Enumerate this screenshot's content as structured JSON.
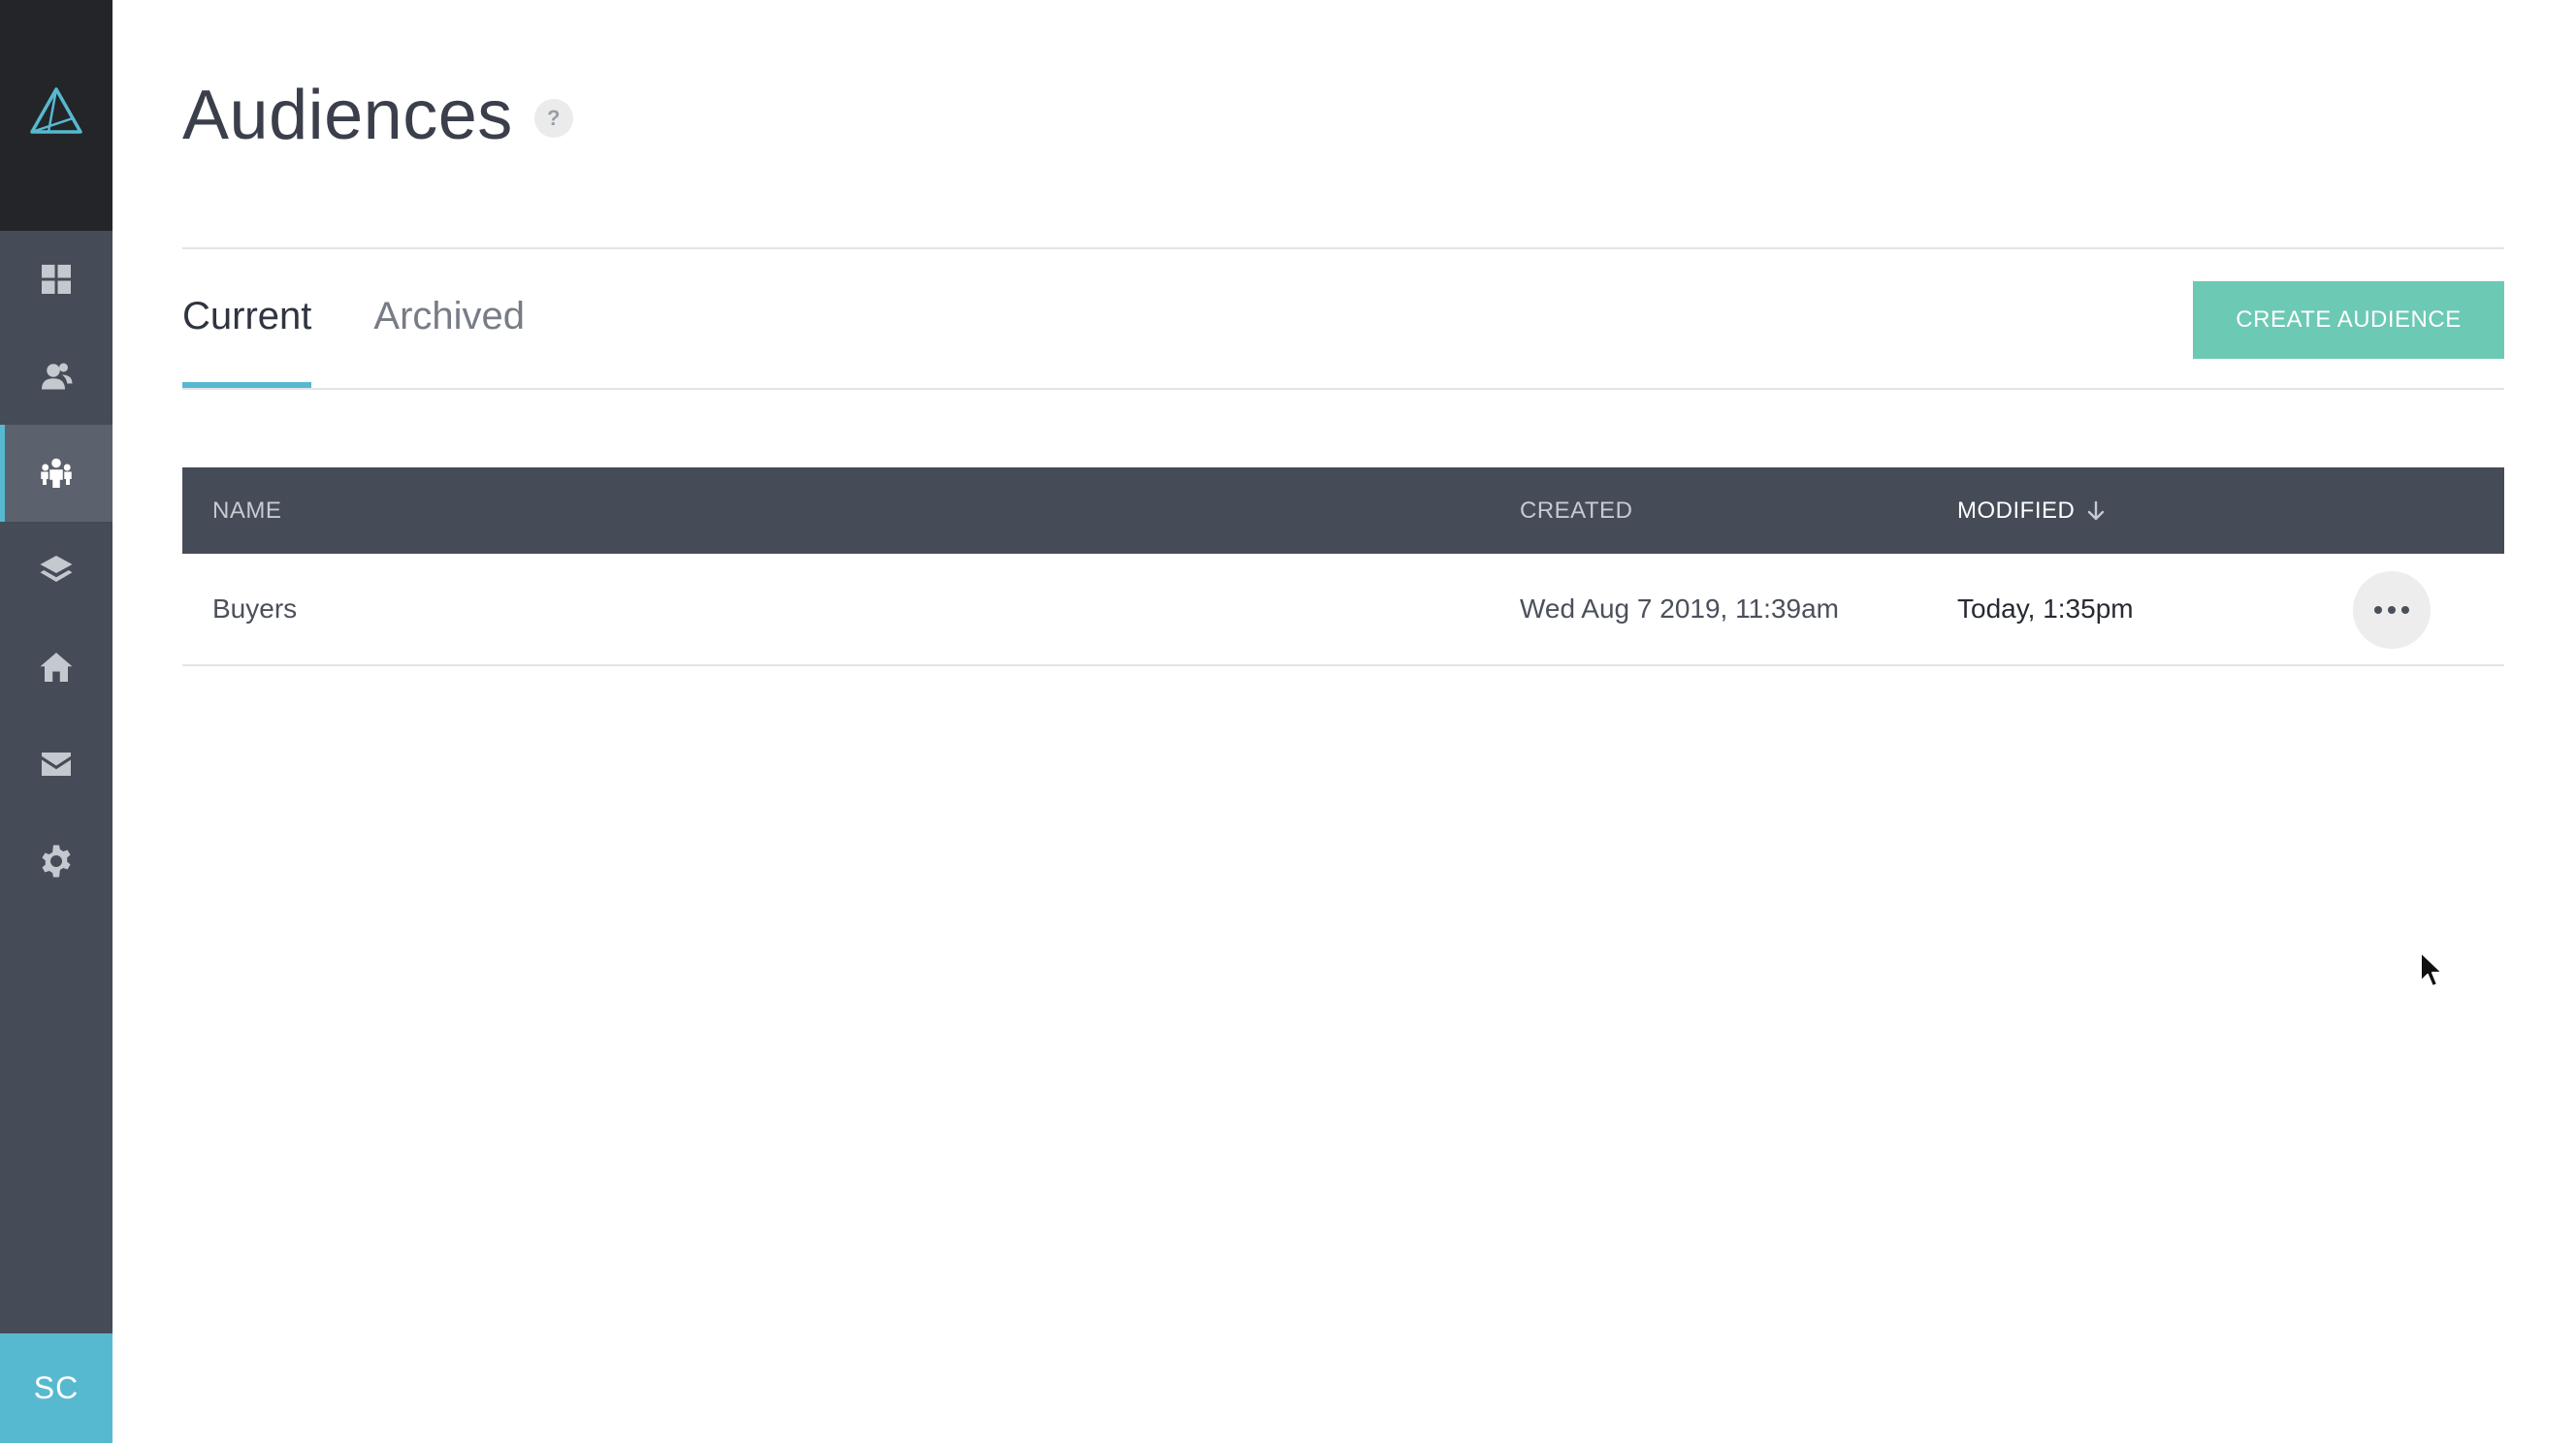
{
  "sidebar": {
    "logo_icon": "triangle-logo-icon",
    "items": [
      {
        "name": "dashboard",
        "icon": "grid-icon",
        "active": false
      },
      {
        "name": "contacts",
        "icon": "users-icon",
        "active": false
      },
      {
        "name": "audiences",
        "icon": "group-icon",
        "active": true
      },
      {
        "name": "layers",
        "icon": "layers-icon",
        "active": false
      },
      {
        "name": "home",
        "icon": "home-icon",
        "active": false
      },
      {
        "name": "mail",
        "icon": "mail-icon",
        "active": false
      },
      {
        "name": "settings",
        "icon": "gear-icon",
        "active": false
      }
    ],
    "avatar_initials": "SC",
    "accent_color": "#57b9d0"
  },
  "page": {
    "title": "Audiences",
    "help_label": "?"
  },
  "tabs": [
    {
      "label": "Current",
      "active": true
    },
    {
      "label": "Archived",
      "active": false
    }
  ],
  "toolbar": {
    "create_label": "CREATE AUDIENCE",
    "create_color": "#6cc9b4"
  },
  "table": {
    "columns": {
      "name": "NAME",
      "created": "CREATED",
      "modified": "MODIFIED"
    },
    "sorted_by": "modified",
    "rows": [
      {
        "name": "Buyers",
        "created": "Wed Aug 7 2019, 11:39am",
        "modified": "Today, 1:35pm"
      }
    ]
  }
}
